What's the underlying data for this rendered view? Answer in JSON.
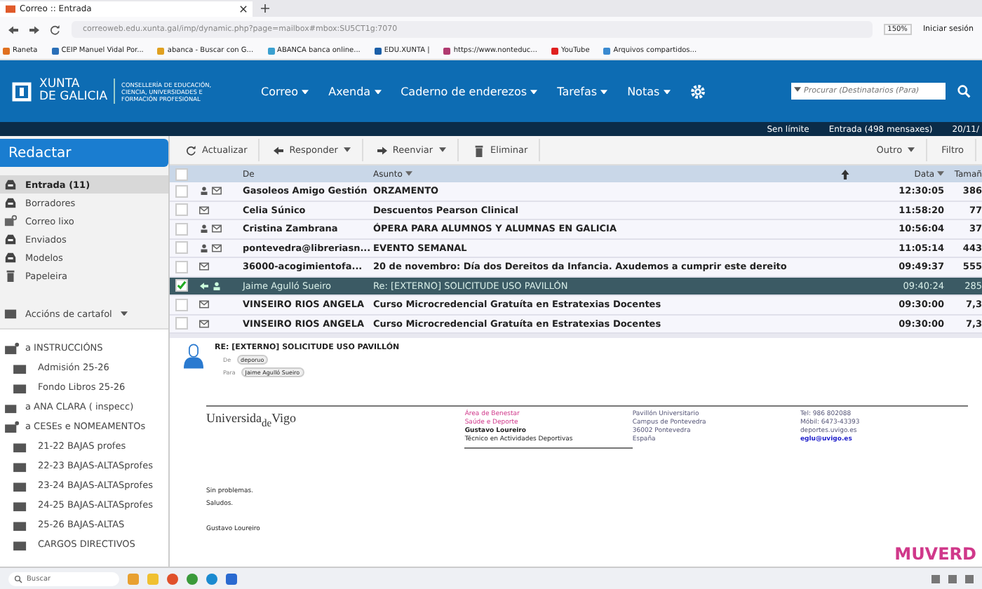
{
  "browser": {
    "tab_title": "Correo :: Entrada",
    "url": "correoweb.edu.xunta.gal/imp/dynamic.php?page=mailbox#mbox:SU5CT1g:7070",
    "zoom": "150%",
    "sign_in": "Iniciar sesión",
    "bookmarks": [
      {
        "label": "Raneta",
        "color": "#e07020"
      },
      {
        "label": "CEIP Manuel Vidal Por...",
        "color": "#2a6fb8"
      },
      {
        "label": "abanca - Buscar con G...",
        "color": "#e0a020"
      },
      {
        "label": "ABANCA banca online...",
        "color": "#3aa0d0"
      },
      {
        "label": "EDU.XUNTA |",
        "color": "#1b5fa8"
      },
      {
        "label": "https://www.nonteduc...",
        "color": "#b03a70"
      },
      {
        "label": "YouTube",
        "color": "#e02020"
      },
      {
        "label": "Arquivos compartidos...",
        "color": "#3a8ad0"
      }
    ]
  },
  "header": {
    "logo_line1": "XUNTA",
    "logo_line2": "DE GALICIA",
    "department": "CONSELLERÍA DE EDUCACIÓN, CIENCIA, UNIVERSIDADES E FORMACIÓN PROFESIONAL",
    "nav": [
      "Correo",
      "Axenda",
      "Caderno de enderezos",
      "Tarefas",
      "Notas"
    ],
    "search": {
      "placeholder": "Procurar (Destinatarios (Para)"
    }
  },
  "status_bar": {
    "quota": "Sen límite",
    "mailbox": "Entrada (498 mensaxes)",
    "date": "20/11/"
  },
  "sidebar": {
    "compose": "Redactar",
    "folders": [
      {
        "label": "Entrada (11)",
        "kind": "inbox",
        "selected": true
      },
      {
        "label": "Borradores",
        "kind": "drafts",
        "selected": false
      },
      {
        "label": "Correo lixo",
        "kind": "spam",
        "selected": false
      },
      {
        "label": "Enviados",
        "kind": "inbox",
        "selected": false
      },
      {
        "label": "Modelos",
        "kind": "drafts",
        "selected": false
      },
      {
        "label": "Papeleira",
        "kind": "trash",
        "selected": false
      }
    ],
    "folder_actions": "Accións de cartafol",
    "tree": [
      {
        "label": "a INSTRUCCIÓNS",
        "children": [
          {
            "label": "Admisión 25-26"
          },
          {
            "label": "Fondo Libros 25-26"
          }
        ]
      },
      {
        "label": "a ANA CLARA ( inspecc)"
      },
      {
        "label": "a CESEs e NOMEAMENTOs",
        "children": [
          {
            "label": "21-22 BAJAS profes"
          },
          {
            "label": "22-23 BAJAS-ALTASprofes"
          },
          {
            "label": "23-24 BAJAS-ALTASprofes"
          },
          {
            "label": "24-25 BAJAS-ALTASprofes"
          },
          {
            "label": "25-26 BAJAS-ALTAS"
          },
          {
            "label": "CARGOS DIRECTIVOS"
          }
        ]
      }
    ]
  },
  "toolbar": [
    {
      "label": "Actualizar",
      "kind": "refresh"
    },
    {
      "label": "Responder",
      "kind": "reply"
    },
    {
      "label": "Reenviar",
      "kind": "forward"
    },
    {
      "label": "Eliminar",
      "kind": "delete"
    }
  ],
  "toolbar_right": [
    "Outro",
    "Filtro"
  ],
  "table": {
    "columns": [
      "De",
      "Asunto",
      "Data",
      "Tamañ"
    ],
    "select_all_checked": false,
    "rows": [
      {
        "from": "Gasoleos Amigo Gestión",
        "subject": "ORZAMENTO",
        "date": "12:30:05",
        "size": "386",
        "unread": true,
        "selected": false,
        "checked": false,
        "answered": false,
        "contact": true
      },
      {
        "from": "Celia Súnico",
        "subject": "Descuentos Pearson Clinical",
        "date": "11:58:20",
        "size": "77",
        "unread": true,
        "selected": false,
        "checked": false,
        "answered": false,
        "contact": false
      },
      {
        "from": "Cristina Zambrana",
        "subject": "ÓPERA PARA ALUMNOS Y ALUMNAS EN GALICIA",
        "date": "10:56:04",
        "size": "37",
        "unread": true,
        "selected": false,
        "checked": false,
        "answered": false,
        "contact": true
      },
      {
        "from": "pontevedra@libreriasn...",
        "subject": "EVENTO SEMANAL",
        "date": "11:05:14",
        "size": "443",
        "unread": true,
        "selected": false,
        "checked": false,
        "answered": false,
        "contact": true
      },
      {
        "from": "36000-acogimientofa...",
        "subject": "20 de novembro: Día dos Dereitos da Infancia. Axudemos a cumprir este dereito",
        "date": "09:49:37",
        "size": "555",
        "unread": true,
        "selected": false,
        "checked": false,
        "answered": false,
        "contact": false
      },
      {
        "from": "Jaime Agulló Sueiro",
        "subject": "Re: [EXTERNO] SOLICITUDE USO PAVILLÓN",
        "date": "09:40:24",
        "size": "285",
        "unread": false,
        "selected": true,
        "checked": true,
        "answered": true,
        "contact": true
      },
      {
        "from": "VINSEIRO RIOS ANGELA",
        "subject": "Curso Microcredencial Gratuíta en Estratexias Docentes",
        "date": "09:30:00",
        "size": "7,3",
        "unread": true,
        "selected": false,
        "checked": false,
        "answered": false,
        "contact": false
      },
      {
        "from": "VINSEIRO RIOS ANGELA",
        "subject": "Curso Microcredencial Gratuíta en Estratexias Docentes",
        "date": "09:30:00",
        "size": "7,3",
        "unread": true,
        "selected": false,
        "checked": false,
        "answered": false,
        "contact": false
      }
    ]
  },
  "preview": {
    "subject": "RE: [EXTERNO] SOLICITUDE USO PAVILLÓN",
    "from_label": "De",
    "from": "deporuo",
    "to_label": "Para",
    "to": "Jaime Agulló Sueiro",
    "signature": {
      "logo": "Universida$_{de}$Vigo",
      "col_1": [
        {
          "text": "Área de Benestar",
          "kind": "accent"
        },
        {
          "text": "Saúde e Deporte",
          "kind": "accent"
        },
        {
          "text": "Gustavo Loureiro",
          "kind": "bold"
        },
        {
          "text": "Técnico en Actividades Deportivas",
          "kind": "plain"
        }
      ],
      "col_2": [
        {
          "text": "Pavillón Universitario",
          "kind": "info"
        },
        {
          "text": "Campus de Pontevedra",
          "kind": "info"
        },
        {
          "text": "36002 Pontevedra",
          "kind": "info"
        },
        {
          "text": "España",
          "kind": "info"
        }
      ],
      "col_3": [
        {
          "text": "Tel: 986 802088",
          "kind": "info"
        },
        {
          "text": "Móbil: 6473-43393",
          "kind": "info"
        },
        {
          "text": "deportes.uvigo.es",
          "kind": "info"
        },
        {
          "text": "eglu@uvigo.es",
          "kind": "link"
        }
      ]
    },
    "body": [
      "Sin problemas.",
      "Saludos."
    ],
    "closing": "Gustavo Loureiro",
    "banner": "MUVERD"
  },
  "taskbar": {
    "search": "Buscar"
  }
}
